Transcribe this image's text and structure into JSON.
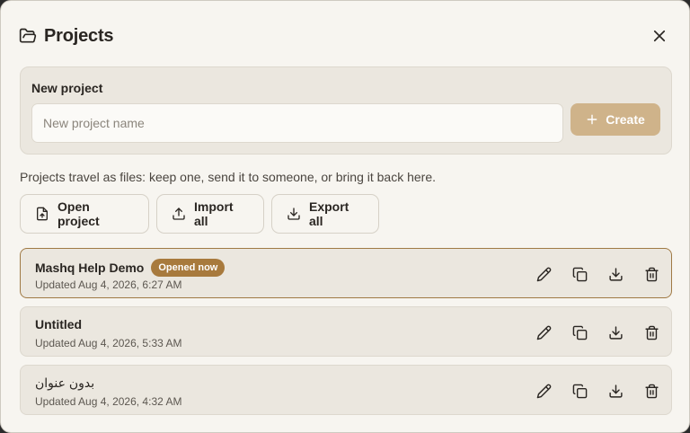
{
  "dialog": {
    "title": "Projects",
    "icons": {
      "title": "folder-open-icon",
      "close": "close-icon"
    }
  },
  "new_project": {
    "label": "New project",
    "input_value": "",
    "placeholder": "New project name",
    "create_label": "Create"
  },
  "help_text": "Projects travel as files: keep one, send it to someone, or bring it back here.",
  "actions": {
    "open": "Open project",
    "import": "Import all",
    "export": "Export all"
  },
  "projects": [
    {
      "name": "Mashq Help Demo",
      "badge": "Opened now",
      "updated": "Updated Aug 4, 2026, 6:27 AM",
      "active": true
    },
    {
      "name": "Untitled",
      "badge": "",
      "updated": "Updated Aug 4, 2026, 5:33 AM",
      "active": false
    },
    {
      "name": "بدون عنوان",
      "badge": "",
      "updated": "Updated Aug 4, 2026, 4:32 AM",
      "active": false
    }
  ],
  "row_icons": [
    "pencil-icon",
    "duplicate-icon",
    "download-icon",
    "trash-icon"
  ],
  "colors": {
    "accent": "#cfb38a",
    "badge": "#a87a3d",
    "active_border": "#a07a45",
    "background": "#f7f5f0",
    "card": "#ebe7df"
  }
}
